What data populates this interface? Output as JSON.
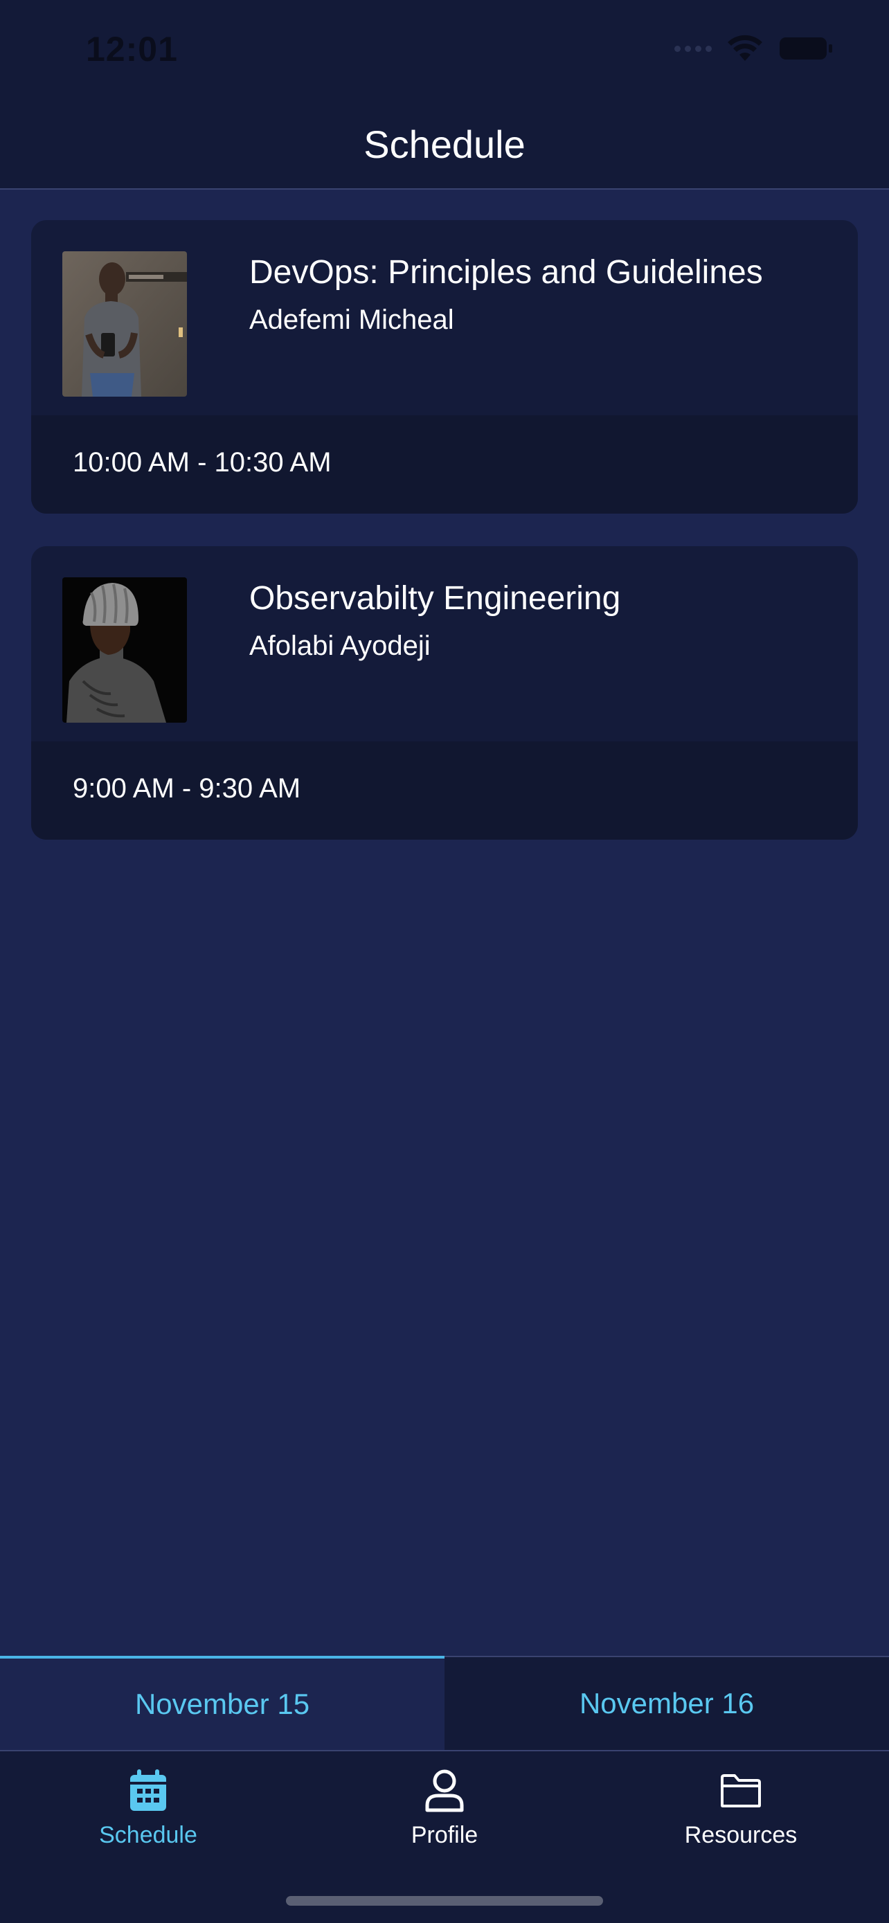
{
  "status_bar": {
    "time": "12:01"
  },
  "header": {
    "title": "Schedule"
  },
  "sessions": [
    {
      "title": "DevOps: Principles and Guidelines",
      "speaker": "Adefemi Micheal",
      "time": "10:00 AM - 10:30 AM"
    },
    {
      "title": "Observabilty Engineering",
      "speaker": "Afolabi Ayodeji",
      "time": "9:00 AM - 9:30 AM"
    }
  ],
  "day_tabs": [
    {
      "label": "November 15",
      "selected": true
    },
    {
      "label": "November 16",
      "selected": false
    }
  ],
  "tab_bar": [
    {
      "label": "Schedule",
      "icon": "calendar-icon",
      "selected": true
    },
    {
      "label": "Profile",
      "icon": "person-icon",
      "selected": false
    },
    {
      "label": "Resources",
      "icon": "folder-icon",
      "selected": false
    }
  ],
  "colors": {
    "accent": "#5ac8f0",
    "background": "#1c2550",
    "card": "#141b3a",
    "bar": "#131a38"
  }
}
